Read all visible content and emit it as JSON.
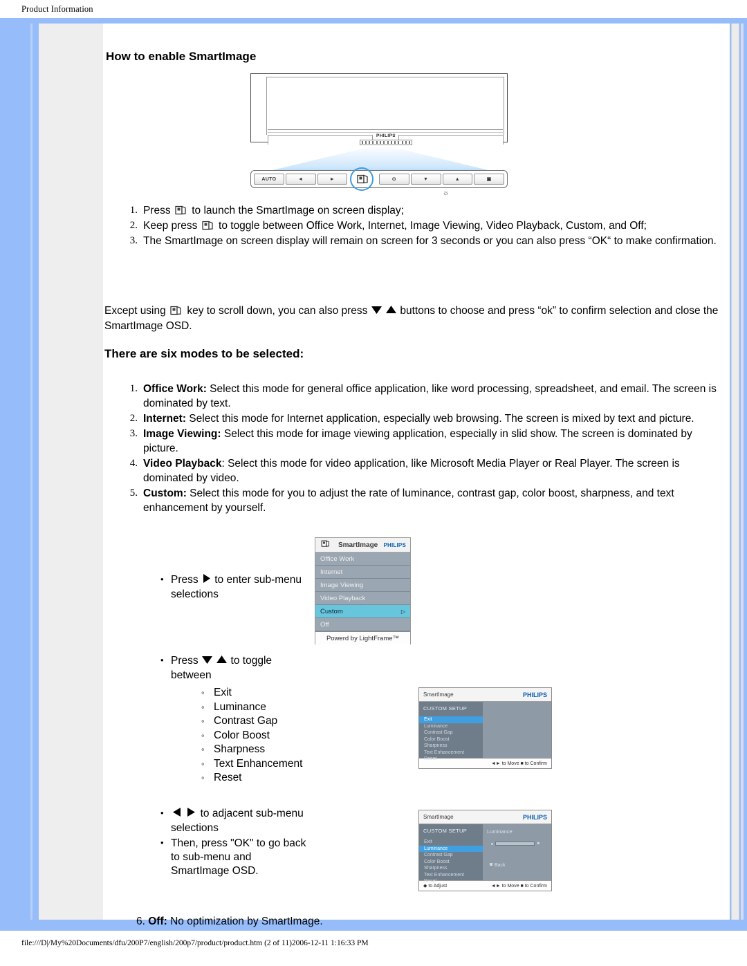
{
  "header": {
    "title": "Product Information"
  },
  "section": {
    "heading": "How to enable SmartImage"
  },
  "monitor": {
    "brand": "PHILIPS",
    "buttons": [
      {
        "name": "auto-button",
        "label": "AUTO"
      },
      {
        "name": "left-button",
        "label": "◄"
      },
      {
        "name": "right-button",
        "label": "►"
      },
      {
        "name": "smartimage-button",
        "label": ""
      },
      {
        "name": "power-button",
        "label": "⊙"
      },
      {
        "name": "down-button",
        "label": "▼"
      },
      {
        "name": "up-button",
        "label": "▲"
      },
      {
        "name": "menu-button",
        "label": "▣"
      }
    ],
    "brightness_mark": "☼"
  },
  "steps": [
    {
      "num": "1.",
      "pre": "Press ",
      "post": " to launch the SmartImage on screen display;"
    },
    {
      "num": "2.",
      "pre": "Keep press ",
      "post": " to toggle between Office Work, Internet, Image Viewing, Video Playback, Custom, and Off;"
    },
    {
      "num": "3.",
      "pre": "",
      "post": "The SmartImage on screen display will remain on screen for 3 seconds or you can also press “OK“ to make confirmation."
    }
  ],
  "except_para": {
    "part1": "Except using ",
    "part2": " key to scroll down, you can also press ",
    "part3": " buttons to choose and press “ok” to confirm selection and close the SmartImage OSD."
  },
  "modes_heading": "There are six modes to be selected:",
  "modes": [
    {
      "num": "1.",
      "name": "Office Work:",
      "desc": " Select this mode for general office application, like word processing, spreadsheet, and email.  The screen is dominated by text."
    },
    {
      "num": "2.",
      "name": "Internet:",
      "desc": " Select this mode for Internet application, especially web browsing.  The screen is mixed by text and picture."
    },
    {
      "num": "3.",
      "name": "Image Viewing:",
      "desc": " Select this mode for image viewing application, especially in slid show.  The screen is dominated by picture."
    },
    {
      "num": "4.",
      "name": "Video Playback",
      "desc": ": Select this mode for video application, like Microsoft Media Player or Real Player.  The screen is dominated by video."
    },
    {
      "num": "5.",
      "name": "Custom:",
      "desc": "  Select this mode for you to adjust the rate of luminance, contrast gap, color boost, sharpness, and text enhancement by yourself."
    }
  ],
  "bullets": {
    "b1_pre": "Press ",
    "b1_post": " to enter sub-menu selections",
    "b2_pre": "Press ",
    "b2_post": " to toggle between",
    "submenu_items": [
      "Exit",
      "Luminance",
      "Contrast Gap",
      "Color Boost",
      "Sharpness",
      "Text Enhancement",
      "Reset"
    ],
    "b3_post": " to adjacent sub-menu selections",
    "b4": "Then, press \"OK\" to go back to sub-menu and SmartImage OSD."
  },
  "final_item": {
    "num": "6.",
    "name": "Off:",
    "desc": " No optimization by SmartImage."
  },
  "osd_smartimage": {
    "title": "SmartImage",
    "brand": "PHILIPS",
    "items": [
      {
        "label": "Office Work",
        "selected": false
      },
      {
        "label": "Internet",
        "selected": false
      },
      {
        "label": "Image Viewing",
        "selected": false
      },
      {
        "label": "Video Playback",
        "selected": false
      },
      {
        "label": "Custom",
        "selected": true,
        "arrow": "▷"
      },
      {
        "label": "Off",
        "selected": false
      }
    ],
    "footer": "Powerd by LightFrame™"
  },
  "osd_custom_setup": {
    "title": "SmartImage",
    "brand": "PHILIPS",
    "menu_title": "CUSTOM SETUP",
    "items": [
      "Exit",
      "Luminance",
      "Contrast Gap",
      "Color Boost",
      "Sharpness",
      "Text Enhancement",
      "Reset"
    ],
    "selected": "Exit",
    "footer_right": "◄► to Move ■ to Confirm"
  },
  "osd_luminance": {
    "title": "SmartImage",
    "brand": "PHILIPS",
    "menu_title": "CUSTOM SETUP",
    "items": [
      "Exit",
      "Luminance",
      "Contrast Gap",
      "Color Boost",
      "Sharpness",
      "Text Enhancement",
      "Reset"
    ],
    "selected": "Luminance",
    "panel_label": "Luminance",
    "back_label": "Back",
    "footer_left": "◆ to Adjust",
    "footer_right": "◄► to Move ■ to Confirm"
  },
  "footer": {
    "path": "file:///D|/My%20Documents/dfu/200P7/english/200p7/product/product.htm (2 of 11)2006-12-11 1:16:33 PM"
  }
}
